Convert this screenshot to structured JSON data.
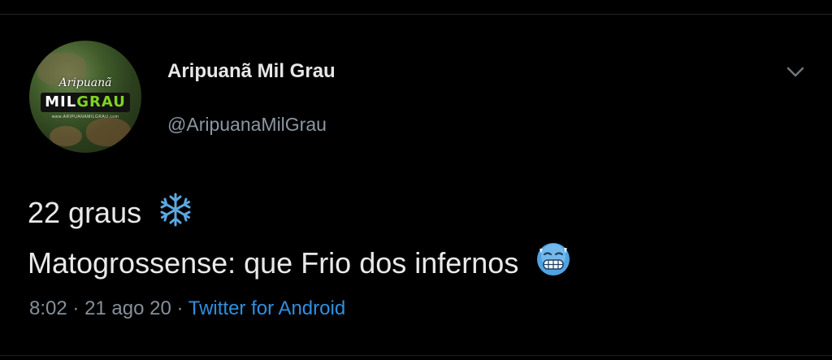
{
  "tweet": {
    "display_name": "Aripuanã Mil Grau",
    "handle": "@AripuanaMilGrau",
    "text_line1": "22 graus",
    "text_line2": "Matogrossense: que Frio dos infernos",
    "emoji1": "snowflake-icon",
    "emoji2": "cold-face-icon",
    "time": "8:02",
    "date": "21 ago 20",
    "separator": "·",
    "source": "Twitter for Android"
  },
  "avatar": {
    "logo_top": "Aripuanã",
    "logo_main_a": "MIL",
    "logo_main_b": "GRAU",
    "logo_sub": "www.ARIPUANAMILGRAU.com"
  },
  "colors": {
    "background": "#000000",
    "text": "#e9e9e9",
    "secondary": "#8b97a2",
    "link": "#2f8fe0",
    "emoji_blue": "#5aa8e0"
  }
}
